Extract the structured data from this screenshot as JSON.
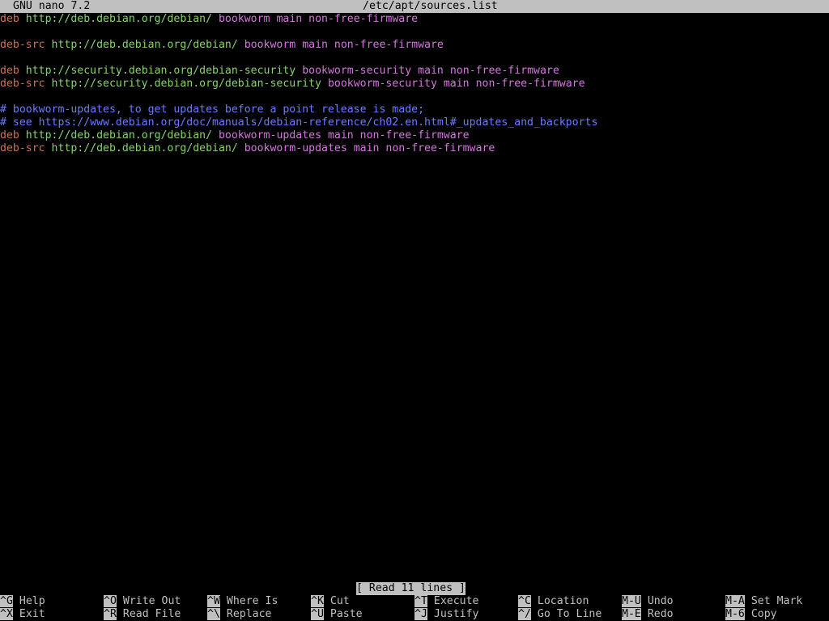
{
  "header": {
    "app_version": "GNU nano 7.2",
    "filename": "/etc/apt/sources.list"
  },
  "lines": [
    {
      "type": "deb",
      "kw": "deb",
      "url": "http://deb.debian.org/debian/",
      "rest": "bookworm main non-free-firmware"
    },
    {
      "type": "blank"
    },
    {
      "type": "deb",
      "kw": "deb-src",
      "url": "http://deb.debian.org/debian/",
      "rest": "bookworm main non-free-firmware"
    },
    {
      "type": "blank"
    },
    {
      "type": "deb",
      "kw": "deb",
      "url": "http://security.debian.org/debian-security",
      "rest": "bookworm-security main non-free-firmware"
    },
    {
      "type": "deb",
      "kw": "deb-src",
      "url": "http://security.debian.org/debian-security",
      "rest": "bookworm-security main non-free-firmware"
    },
    {
      "type": "blank"
    },
    {
      "type": "comment",
      "text": "# bookworm-updates, to get updates before a point release is made;"
    },
    {
      "type": "comment",
      "text": "# see https://www.debian.org/doc/manuals/debian-reference/ch02.en.html#_updates_and_backports"
    },
    {
      "type": "deb",
      "kw": "deb",
      "url": "http://deb.debian.org/debian/",
      "rest": "bookworm-updates main non-free-firmware"
    },
    {
      "type": "deb",
      "kw": "deb-src",
      "url": "http://deb.debian.org/debian/",
      "rest": "bookworm-updates main non-free-firmware"
    }
  ],
  "status_message": "[ Read 11 lines ]",
  "shortcuts": [
    [
      {
        "key": "^G",
        "label": "Help"
      },
      {
        "key": "^X",
        "label": "Exit"
      }
    ],
    [
      {
        "key": "^O",
        "label": "Write Out"
      },
      {
        "key": "^R",
        "label": "Read File"
      }
    ],
    [
      {
        "key": "^W",
        "label": "Where Is"
      },
      {
        "key": "^\\",
        "label": "Replace"
      }
    ],
    [
      {
        "key": "^K",
        "label": "Cut"
      },
      {
        "key": "^U",
        "label": "Paste"
      }
    ],
    [
      {
        "key": "^T",
        "label": "Execute"
      },
      {
        "key": "^J",
        "label": "Justify"
      }
    ],
    [
      {
        "key": "^C",
        "label": "Location"
      },
      {
        "key": "^/",
        "label": "Go To Line"
      }
    ],
    [
      {
        "key": "M-U",
        "label": "Undo"
      },
      {
        "key": "M-E",
        "label": "Redo"
      }
    ],
    [
      {
        "key": "M-A",
        "label": "Set Mark"
      },
      {
        "key": "M-6",
        "label": "Copy"
      }
    ]
  ],
  "colors": {
    "background": "#000000",
    "bar": "#c0c0c0",
    "keyword": "#d07050",
    "url": "#86d36a",
    "suite": "#d675e0",
    "comment": "#6b7bff"
  }
}
